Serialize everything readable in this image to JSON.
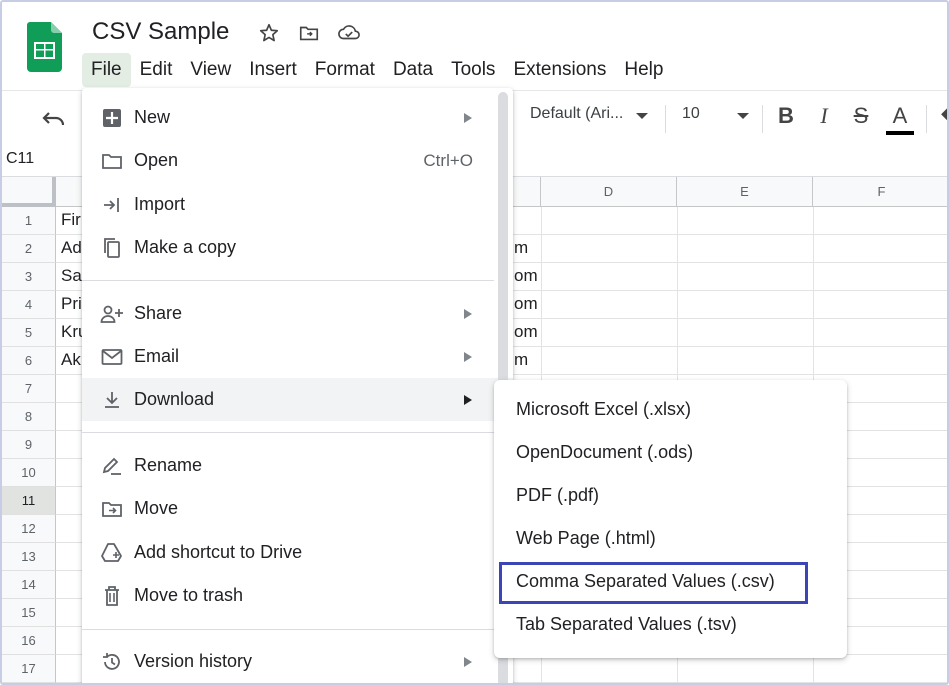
{
  "app": {
    "title": "CSV Sample",
    "brand_color": "#0f9d58"
  },
  "menubar": [
    "File",
    "Edit",
    "View",
    "Insert",
    "Format",
    "Data",
    "Tools",
    "Extensions",
    "Help"
  ],
  "toolbar": {
    "font": "Default (Ari...",
    "font_size": "10",
    "bold": "B",
    "italic": "I",
    "strike": "S",
    "text_color": "A"
  },
  "name_box": "C11",
  "columns": [
    "D",
    "E",
    "F"
  ],
  "rows": [
    "1",
    "2",
    "3",
    "4",
    "5",
    "6",
    "7",
    "8",
    "9",
    "10",
    "11",
    "12",
    "13",
    "14",
    "15",
    "16",
    "17"
  ],
  "cells_col_a": [
    "Fir",
    "Ad",
    "Sa",
    "Pri",
    "Kru",
    "Ak"
  ],
  "cells_col_c": [
    "",
    "m",
    "om",
    "om",
    "om",
    "m"
  ],
  "file_menu": {
    "new": "New",
    "open": "Open",
    "open_shortcut": "Ctrl+O",
    "import": "Import",
    "make_copy": "Make a copy",
    "share": "Share",
    "email": "Email",
    "download": "Download",
    "rename": "Rename",
    "move": "Move",
    "add_shortcut": "Add shortcut to Drive",
    "trash": "Move to trash",
    "version_history": "Version history"
  },
  "download_menu": [
    "Microsoft Excel (.xlsx)",
    "OpenDocument (.ods)",
    "PDF (.pdf)",
    "Web Page (.html)",
    "Comma Separated Values (.csv)",
    "Tab Separated Values (.tsv)"
  ],
  "highlight_color": "#3b45b5"
}
